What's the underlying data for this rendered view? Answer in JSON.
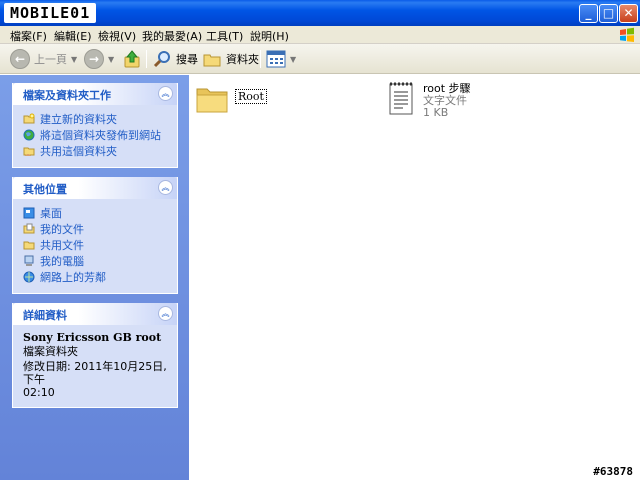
{
  "titlebar": {
    "logo_text": "MOBILE01",
    "min_glyph": "_",
    "max_glyph": "□",
    "close_glyph": "✕"
  },
  "menu": {
    "items": [
      "檔案(F)",
      "編輯(E)",
      "檢視(V)",
      "我的最愛(A)",
      "工具(T)",
      "說明(H)"
    ]
  },
  "toolbar": {
    "back_label": "上一頁",
    "search_label": "搜尋",
    "folders_label": "資料夾"
  },
  "tasks_panel": {
    "title": "檔案及資料夾工作",
    "items": [
      "建立新的資料夾",
      "將這個資料夾發佈到網站",
      "共用這個資料夾"
    ]
  },
  "places_panel": {
    "title": "其他位置",
    "items": [
      "桌面",
      "我的文件",
      "共用文件",
      "我的電腦",
      "網路上的芳鄰"
    ]
  },
  "details_panel": {
    "title": "詳細資料",
    "name": "Sony Ericsson GB root",
    "type": "檔案資料夾",
    "modified_line1": "修改日期: 2011年10月25日, 下午",
    "modified_line2": "02:10"
  },
  "files": [
    {
      "name": "Root",
      "type": "",
      "size": "",
      "icon": "folder-icon"
    },
    {
      "name": "root 步驟",
      "type": "文字文件",
      "size": "1 KB",
      "icon": "text-document-icon"
    }
  ],
  "watermark": "#63878",
  "colors": {
    "title_blue": "#0055e5",
    "panel_link": "#215dc6",
    "left_pane_bg": "#6f8fdf"
  }
}
